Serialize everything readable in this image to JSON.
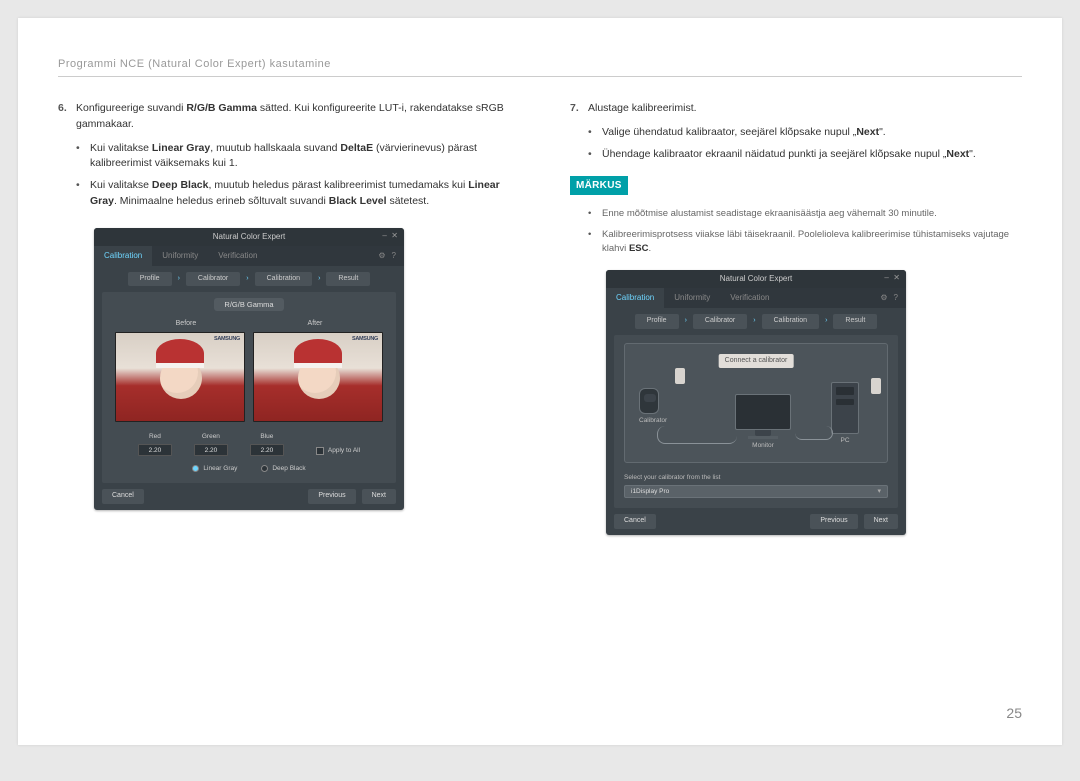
{
  "page": {
    "header": "Programmi NCE (Natural Color Expert) kasutamine",
    "pageNumber": "25"
  },
  "left": {
    "item6_num": "6.",
    "item6_text_pre": "Konfigureerige suvandi ",
    "item6_bold1": "R/G/B Gamma",
    "item6_text_mid": " sätted. Kui konfigureerite LUT-i, rakendatakse sRGB gammakaar.",
    "bullet1_pre": "Kui valitakse ",
    "bullet1_b1": "Linear Gray",
    "bullet1_mid": ", muutub hallskaala suvand ",
    "bullet1_b2": "DeltaE",
    "bullet1_post": " (värvierinevus) pärast kalibreerimist väiksemaks kui 1.",
    "bullet2_pre": "Kui valitakse ",
    "bullet2_b1": "Deep Black",
    "bullet2_mid": ", muutub heledus pärast kalibreerimist tumedamaks kui ",
    "bullet2_b2": "Linear Gray",
    "bullet2_post": ". Minimaalne heledus erineb sõltuvalt suvandi ",
    "bullet2_b3": "Black Level",
    "bullet2_end": " sätetest."
  },
  "right": {
    "item7_num": "7.",
    "item7_text": "Alustage kalibreerimist.",
    "rb1_pre": "Valige ühendatud kalibraator, seejärel klõpsake nupul „",
    "rb1_b": "Next",
    "rb1_post": "\".",
    "rb2_pre": "Ühendage kalibraator ekraanil näidatud punkti ja seejärel klõpsake nupul „",
    "rb2_b": "Next",
    "rb2_post": "\".",
    "markus": "MÄRKUS",
    "note1": "Enne mõõtmise alustamist seadistage ekraanisäästja aeg vähemalt 30 minutile.",
    "note2_pre": "Kalibreerimisprotsess viiakse läbi täisekraanil. Poolelioleva kalibreerimise tühistamiseks vajutage klahvi ",
    "note2_b": "ESC",
    "note2_post": "."
  },
  "shot1": {
    "title": "Natural Color Expert",
    "tab_calibration": "Calibration",
    "tab_uniformity": "Uniformity",
    "tab_verification": "Verification",
    "stab_profile": "Profile",
    "stab_calibrator": "Calibrator",
    "stab_calibration": "Calibration",
    "stab_result": "Result",
    "panel_title": "R/G/B Gamma",
    "label_before": "Before",
    "label_after": "After",
    "brand": "SAMSUNG",
    "red": "Red",
    "green": "Green",
    "blue": "Blue",
    "val_r": "2.20",
    "val_g": "2.20",
    "val_b": "2.20",
    "apply_all": "Apply to All",
    "r_linear": "Linear Gray",
    "r_deep": "Deep Black",
    "btn_cancel": "Cancel",
    "btn_prev": "Previous",
    "btn_next": "Next"
  },
  "shot2": {
    "title": "Natural Color Expert",
    "tab_calibration": "Calibration",
    "tab_uniformity": "Uniformity",
    "tab_verification": "Verification",
    "stab_profile": "Profile",
    "stab_calibrator": "Calibrator",
    "stab_calibration": "Calibration",
    "stab_result": "Result",
    "hint": "Connect a calibrator",
    "lbl_calibrator": "Calibrator",
    "lbl_monitor": "Monitor",
    "lbl_pc": "PC",
    "select_label": "Select your calibrator from the list",
    "select_value": "i1Display Pro",
    "btn_cancel": "Cancel",
    "btn_prev": "Previous",
    "btn_next": "Next"
  }
}
